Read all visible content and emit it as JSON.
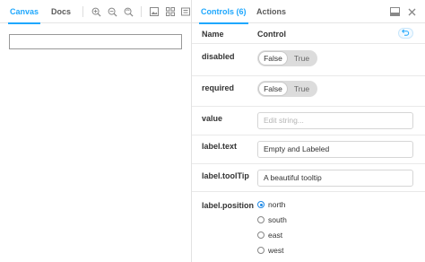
{
  "left_tabs": {
    "canvas": "Canvas",
    "docs": "Docs"
  },
  "toolbar_icons": [
    "zoom-in-icon",
    "zoom-out-icon",
    "zoom-reset-icon",
    "background-icon",
    "grid-icon",
    "viewport-icon"
  ],
  "right_tabs": {
    "controls": "Controls (6)",
    "actions": "Actions"
  },
  "header": {
    "name": "Name",
    "control": "Control"
  },
  "rows": {
    "disabled": {
      "label": "disabled",
      "opt_false": "False",
      "opt_true": "True",
      "value": "False"
    },
    "required": {
      "label": "required",
      "opt_false": "False",
      "opt_true": "True",
      "value": "False"
    },
    "value": {
      "label": "value",
      "placeholder": "Edit string..."
    },
    "label_text": {
      "label": "label.text",
      "value": "Empty and Labeled"
    },
    "label_tooltip": {
      "label": "label.toolTip",
      "value": "A beautiful tooltip"
    },
    "label_position": {
      "label": "label.position",
      "options": [
        "north",
        "south",
        "east",
        "west"
      ],
      "selected": "north"
    }
  },
  "colors": {
    "accent": "#1ea7fd",
    "radio_selected": "#1e88e5"
  }
}
